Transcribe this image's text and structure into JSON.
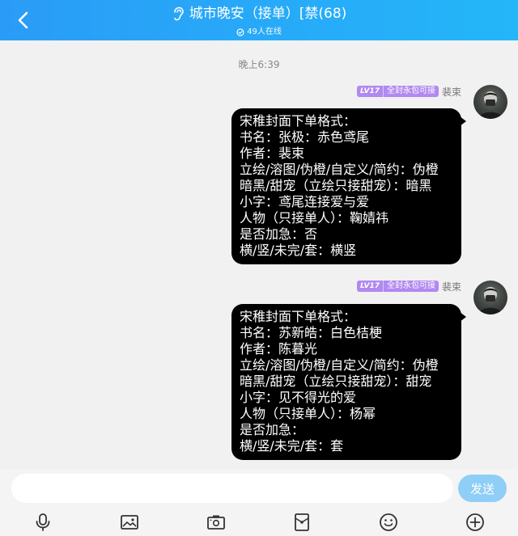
{
  "header": {
    "title": "城市晚安（接单）[禁(68)",
    "online_count": "49人在线"
  },
  "chat": {
    "time_divider": "晚上6:39",
    "messages": [
      {
        "sender": "裴束",
        "level": "LV17",
        "member_title": "全封永包可接",
        "lines": [
          "宋稚封面下单格式：",
          "书名：张极：赤色鸢尾",
          "作者：裴束",
          "立绘/溶图/伪橙/自定义/简约：伪橙",
          "暗黑/甜宠（立绘只接甜宠）：暗黑",
          "小字：鸢尾连接爱与爱",
          "人物（只接单人）：鞠婧祎",
          "是否加急：否",
          "横/竖/未完/套：横竖"
        ]
      },
      {
        "sender": "裴束",
        "level": "LV17",
        "member_title": "全封永包可接",
        "lines": [
          "宋稚封面下单格式：",
          "书名：苏新皓：白色桔梗",
          "作者：陈暮光",
          "立绘/溶图/伪橙/自定义/简约：伪橙",
          "暗黑/甜宠（立绘只接甜宠）：甜宠",
          "小字：见不得光的爱",
          "人物（只接单人）：杨幂",
          "是否加急：",
          "横/竖/未完/套：套"
        ]
      }
    ]
  },
  "input": {
    "value": "",
    "send_label": "发送"
  },
  "toolbar": {
    "icons": [
      "microphone-icon",
      "image-icon",
      "camera-icon",
      "red-packet-icon",
      "emoji-icon",
      "plus-icon"
    ]
  },
  "colors": {
    "header_start": "#2a9cf7",
    "header_end": "#24b6f8",
    "bubble": "#000000",
    "level_badge": "#b189f0",
    "send_button": "#8ecef7"
  }
}
